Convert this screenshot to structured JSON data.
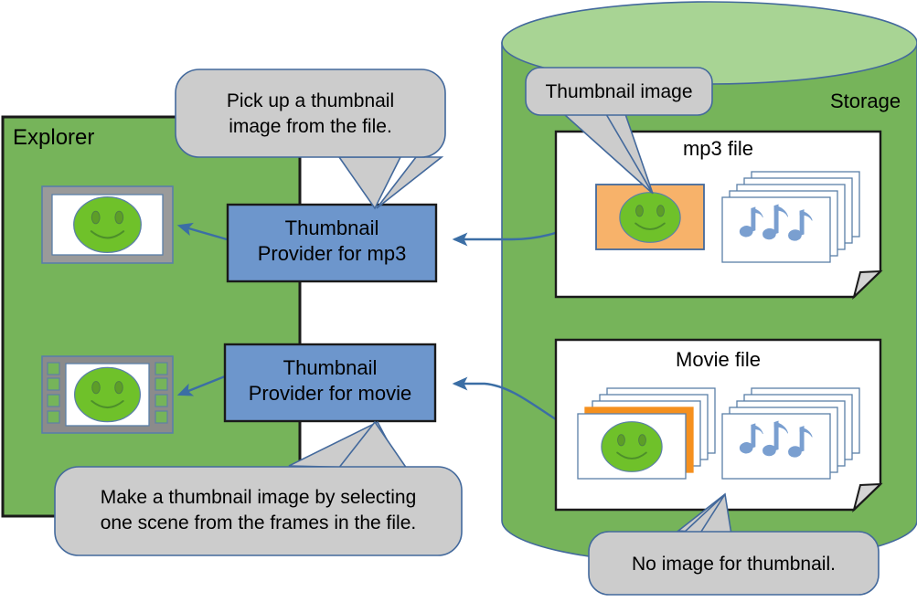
{
  "diagram": {
    "title_hidden": "Thumbnail provider architecture",
    "explorer_panel": {
      "label": "Explorer",
      "fill_color": "#76b45a",
      "border_color": "#1a1a1a",
      "thumbnails": [
        {
          "name": "picture-thumbnail",
          "frame_style": "picture-frame"
        },
        {
          "name": "movie-thumbnail",
          "frame_style": "film-strip"
        }
      ]
    },
    "providers": [
      {
        "id": "provider-mp3",
        "line1": "Thumbnail",
        "line2": "Provider for mp3",
        "fill_color": "#6d96cc",
        "border_color": "#1a1a1a"
      },
      {
        "id": "provider-movie",
        "line1": "Thumbnail",
        "line2": "Provider for movie",
        "fill_color": "#6d96cc",
        "border_color": "#1a1a1a"
      }
    ],
    "storage": {
      "label": "Storage",
      "body_color": "#76b45a",
      "top_color": "#a8d494",
      "outline_color": "#43699c",
      "files": [
        {
          "id": "mp3-file-card",
          "label": "mp3 file",
          "thumbnail_color": "#f7b26a",
          "has_embedded_thumbnail": true,
          "stack_name": "music-note-stack",
          "stack_count": 5
        },
        {
          "id": "movie-file-card",
          "label": "Movie file",
          "thumbnail_color": "#ffffff",
          "highlight_frame_color": "#f5901e",
          "has_embedded_thumbnail": false,
          "frame_stack_count": 5,
          "stack_name": "music-note-stack",
          "stack_count": 5
        }
      ]
    },
    "callouts": [
      {
        "id": "callout-pick-up",
        "line1": "Pick up a thumbnail",
        "line2": "image from the file.",
        "fill_color": "#cccccc",
        "border_color": "#43699c"
      },
      {
        "id": "callout-thumbnail-image",
        "line1": "Thumbnail image",
        "fill_color": "#cccccc",
        "border_color": "#43699c"
      },
      {
        "id": "callout-make-thumbnail",
        "line1": "Make a thumbnail image by selecting",
        "line2": "one scene from the frames in the file.",
        "fill_color": "#cccccc",
        "border_color": "#43699c"
      },
      {
        "id": "callout-no-image",
        "line1": "No image for thumbnail.",
        "fill_color": "#cccccc",
        "border_color": "#43699c"
      }
    ],
    "arrows": {
      "color": "#3b6ea5",
      "items": [
        {
          "name": "arrow-mp3-provider-to-explorer",
          "direction": "left"
        },
        {
          "name": "arrow-storage-to-mp3-provider",
          "direction": "left"
        },
        {
          "name": "arrow-movie-provider-to-explorer",
          "direction": "left"
        },
        {
          "name": "arrow-storage-to-movie-provider",
          "direction": "left"
        }
      ]
    },
    "smiley": {
      "face_color": "#6fc12a",
      "stroke_color": "#5a7fa8"
    }
  }
}
